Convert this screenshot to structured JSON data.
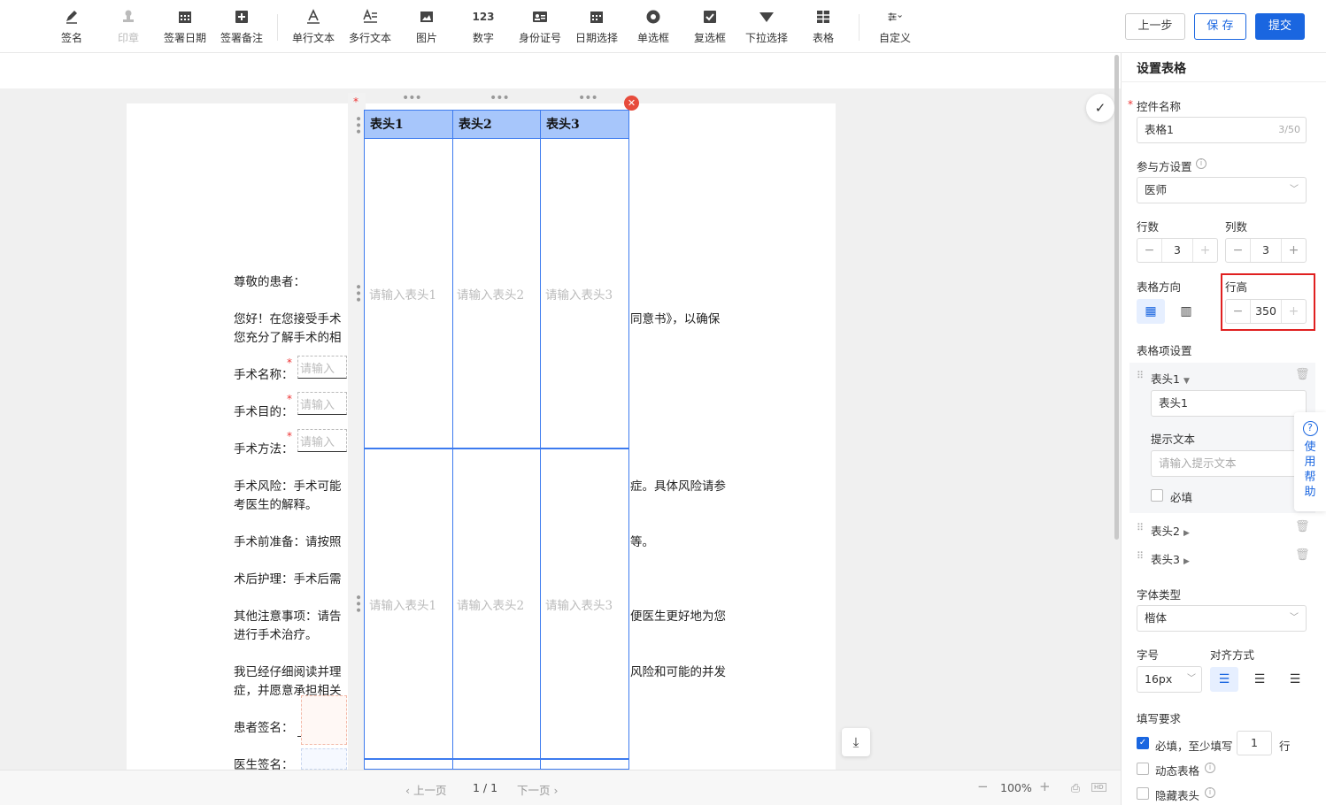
{
  "toolbar": {
    "tools": [
      {
        "label": "签名",
        "icon": "pen-icon",
        "enabled": true
      },
      {
        "label": "印章",
        "icon": "stamp-icon",
        "enabled": false
      },
      {
        "label": "签署日期",
        "icon": "calendar-icon",
        "enabled": true
      },
      {
        "label": "签署备注",
        "icon": "note-add-icon",
        "enabled": true
      },
      {
        "label": "单行文本",
        "icon": "text-a-icon",
        "enabled": true
      },
      {
        "label": "多行文本",
        "icon": "multiline-text-icon",
        "enabled": true
      },
      {
        "label": "图片",
        "icon": "image-icon",
        "enabled": true
      },
      {
        "label": "数字",
        "icon": "number-123-icon",
        "enabled": true
      },
      {
        "label": "身份证号",
        "icon": "id-card-icon",
        "enabled": true
      },
      {
        "label": "日期选择",
        "icon": "date-picker-icon",
        "enabled": true
      },
      {
        "label": "单选框",
        "icon": "radio-icon",
        "enabled": true
      },
      {
        "label": "复选框",
        "icon": "checkbox-icon",
        "enabled": true
      },
      {
        "label": "下拉选择",
        "icon": "dropdown-triangle-icon",
        "enabled": true
      },
      {
        "label": "表格",
        "icon": "table-icon",
        "enabled": true
      },
      {
        "label": "自定义",
        "icon": "sliders-icon",
        "enabled": true
      }
    ],
    "prev_label": "上一步",
    "save_label": "保 存",
    "submit_label": "提交"
  },
  "document": {
    "greeting": "尊敬的患者：",
    "p1_line1a": "您好！在您接受手术",
    "p1_line1b": "同意书》，以确保",
    "p1_line2": "您充分了解手术的相",
    "field_name_label": "手术名称：",
    "field_goal_label": "手术目的：",
    "field_method_label": "手术方法：",
    "field_placeholder": "请输入",
    "risk_line1a": "手术风险：手术可能",
    "risk_line1b": "症。具体风险请参",
    "risk_line2": "考医生的解释。",
    "prep_a": "手术前准备：请按照",
    "prep_b": "等。",
    "care": "术后护理：手术后需",
    "other_line1a": "其他注意事项：请告",
    "other_line1b": "便医生更好地为您",
    "other_line2": "进行手术治疗。",
    "consent_line1a": "我已经仔细阅读并理",
    "consent_line1b": "风险和可能的并发",
    "consent_line2": "症，并愿意承担相关",
    "patient_sign": "患者签名：",
    "doctor_sign": "医生签名："
  },
  "table": {
    "headers": [
      "表头1",
      "表头2",
      "表头3"
    ],
    "placeholders": [
      "请输入表头1",
      "请输入表头2",
      "请输入表头3"
    ]
  },
  "pager": {
    "prev": "上一页",
    "page": "1 / 1",
    "next": "下一页",
    "zoom": "100%"
  },
  "panel": {
    "title": "设置表格",
    "control_name_label": "控件名称",
    "control_name_value": "表格1",
    "control_name_count": "3/50",
    "participant_label": "参与方设置",
    "participant_value": "医师",
    "rows_label": "行数",
    "rows_value": "3",
    "cols_label": "列数",
    "cols_value": "3",
    "direction_label": "表格方向",
    "row_height_label": "行高",
    "row_height_value": "350",
    "items_label": "表格项设置",
    "items": [
      "表头1",
      "表头2",
      "表头3"
    ],
    "item1_value": "表头1",
    "hint_label": "提示文本",
    "hint_placeholder": "请输入提示文本",
    "required_label": "必填",
    "font_type_label": "字体类型",
    "font_type_value": "楷体",
    "font_size_label": "字号",
    "font_size_value": "16px",
    "align_label": "对齐方式",
    "fill_req_label": "填写要求",
    "min_fill_label": "必填，至少填写",
    "min_fill_value": "1",
    "min_fill_unit": "行",
    "dynamic_label": "动态表格",
    "hide_header_label": "隐藏表头",
    "help_text": "使用帮助"
  },
  "colors": {
    "accent": "#1a66e0",
    "table_border": "#3d7bef",
    "table_header": "#a7c6fb",
    "highlight_box": "#e02020"
  }
}
